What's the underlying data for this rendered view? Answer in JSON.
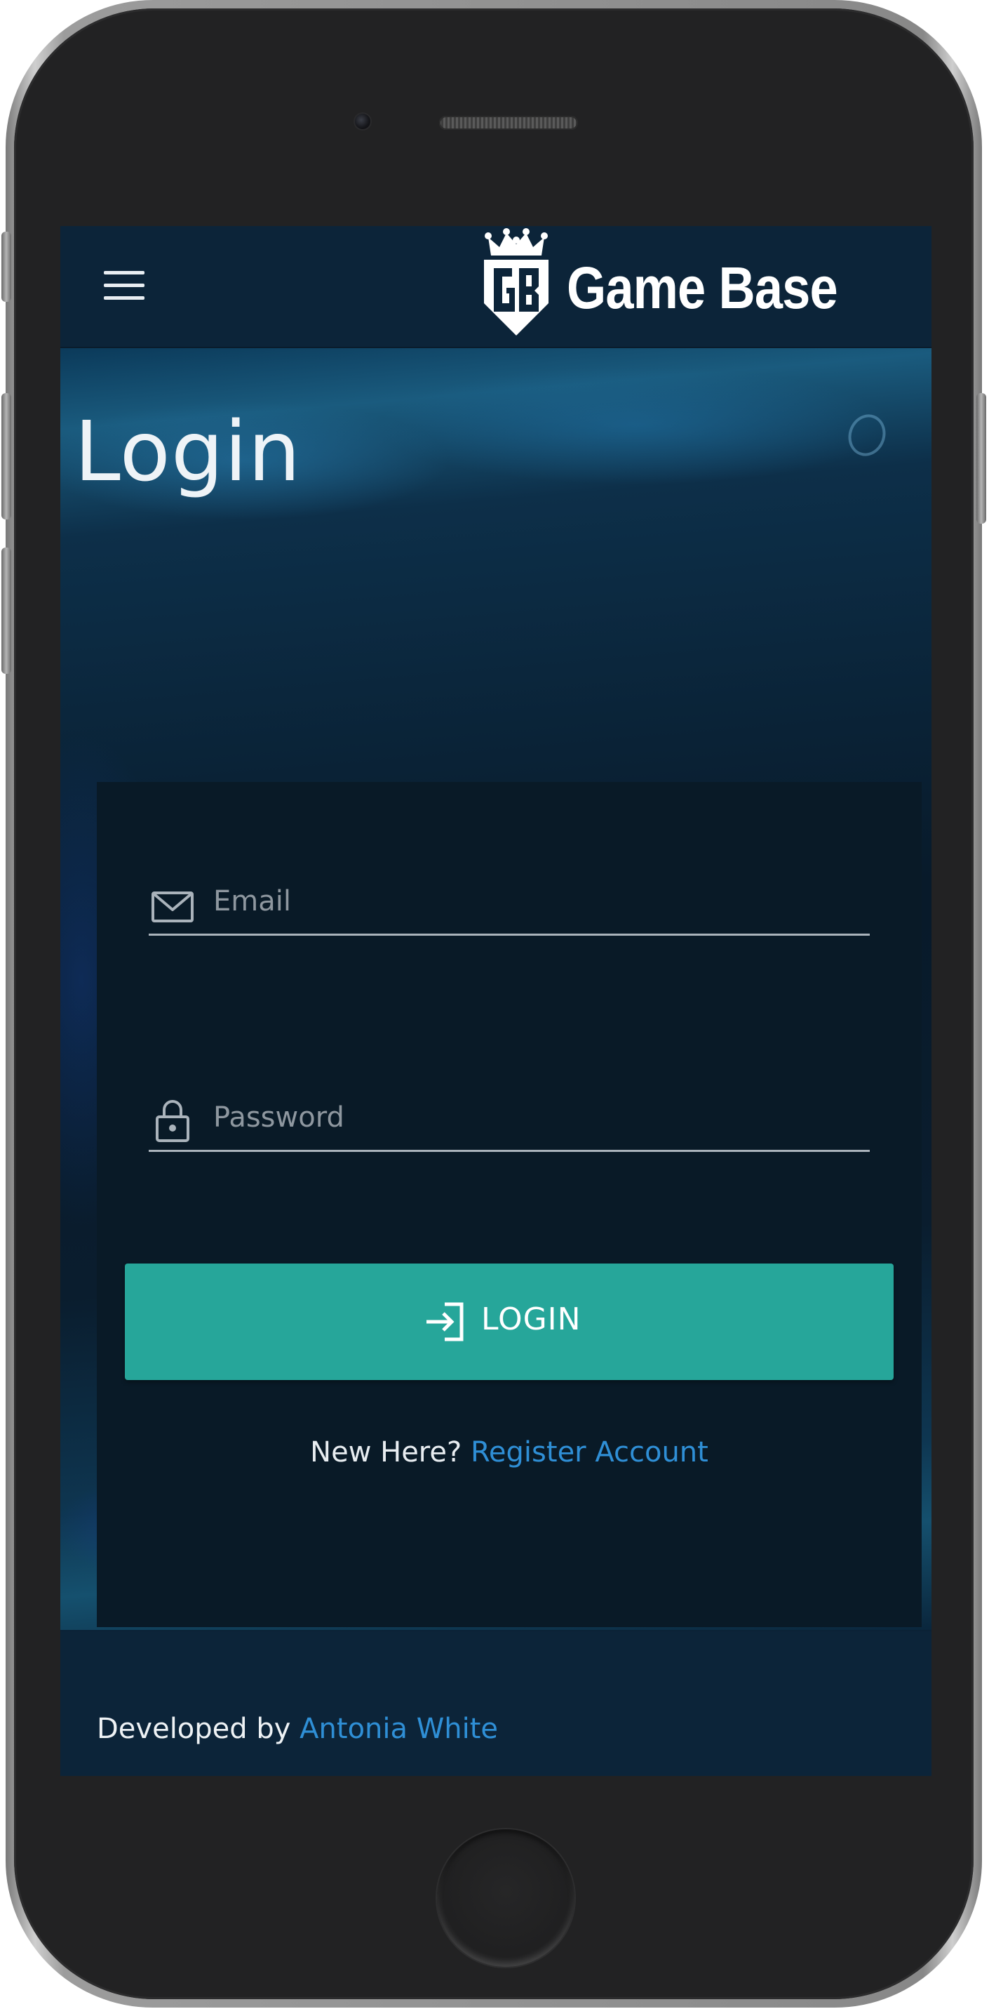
{
  "header": {
    "brand_name": "Game Base",
    "logo_letters": "GB",
    "menu_icon": "hamburger-menu-icon"
  },
  "main": {
    "title": "Login",
    "form": {
      "email": {
        "placeholder": "Email",
        "value": "",
        "icon": "envelope-icon"
      },
      "password": {
        "placeholder": "Password",
        "value": "",
        "icon": "lock-icon"
      },
      "submit": {
        "label": "LOGIN",
        "icon": "login-arrow-icon"
      },
      "register_prompt": "New Here?",
      "register_link": "Register Account"
    }
  },
  "footer": {
    "prefix": "Developed by",
    "author": "Antonia White"
  },
  "colors": {
    "accent": "#26a69a",
    "link": "#2f8fd6",
    "navbar": "#0c2439",
    "card": "#091a27",
    "device_body": "#222223"
  }
}
